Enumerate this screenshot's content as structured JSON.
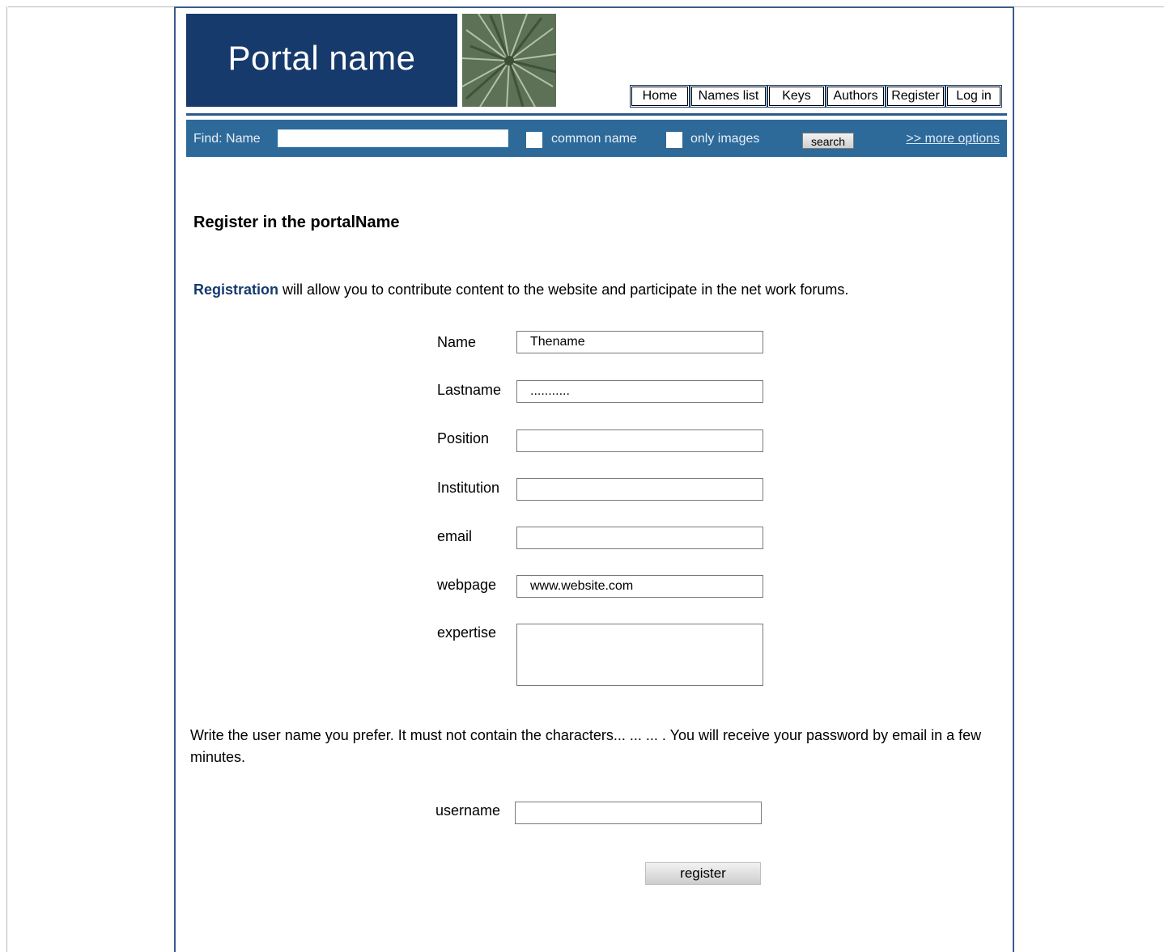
{
  "header": {
    "logo_text": "Portal name",
    "nav": [
      "Home",
      "Names list",
      "Keys",
      "Authors",
      "Register",
      "Log in"
    ]
  },
  "findbar": {
    "label": "Find:  Name",
    "input_value": "",
    "common_name_label": "common name",
    "only_images_label": "only images",
    "search_label": "search",
    "more_options": ">> more options"
  },
  "page": {
    "heading": "Register in the portalName",
    "intro_strong": "Registration",
    "intro_rest": " will allow you to contribute content to the website and participate in the net work forums."
  },
  "form": {
    "name_label": "Name",
    "name_value": "Thename",
    "lastname_label": "Lastname",
    "lastname_value": "...........",
    "position_label": "Position",
    "position_value": "",
    "institution_label": "Institution",
    "institution_value": "",
    "email_label": "email",
    "email_value": "",
    "webpage_label": "webpage",
    "webpage_value": "www.website.com",
    "expertise_label": "expertise",
    "expertise_value": ""
  },
  "note": "Write the user name you prefer. It must not contain the characters... ... ... . You will receive your password by email in a few minutes.",
  "username": {
    "label": "username",
    "value": ""
  },
  "register_button": "register",
  "colors": {
    "logo_bg": "#163a6c",
    "findbar_bg": "#2d6a9a",
    "frame_border": "#3a5c8c"
  }
}
